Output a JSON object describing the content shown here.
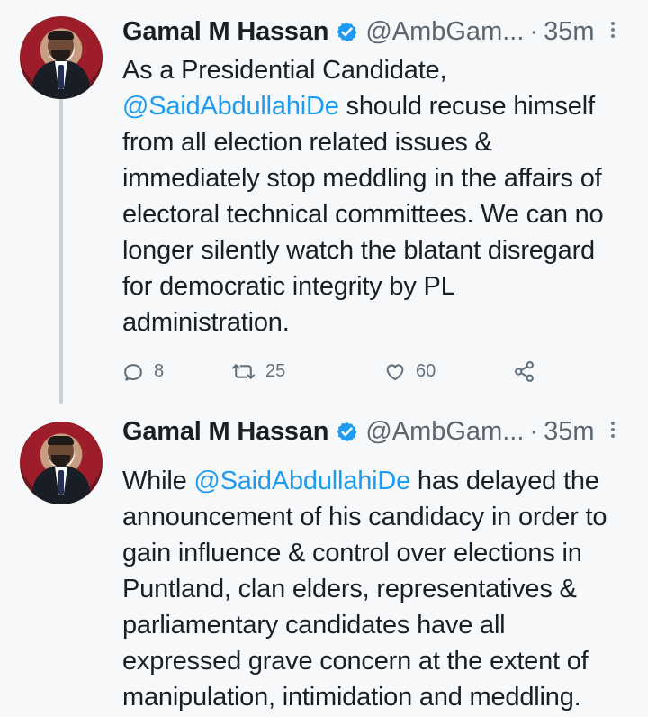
{
  "tweets": [
    {
      "author_name": "Gamal M Hassan",
      "handle": "@AmbGam...",
      "separator": "·",
      "time": "35m",
      "body_parts": [
        {
          "text": "As a Presidential Candidate,\n"
        },
        {
          "text": "@SaidAbdullahiDe",
          "mention": true
        },
        {
          "text": " should recuse himself from all election related issues & immediately stop meddling in the affairs of electoral technical committees. We can no longer silently watch the blatant disregard for democratic integrity by  PL administration."
        }
      ],
      "actions": {
        "replies": "8",
        "retweets": "25",
        "likes": "60"
      }
    },
    {
      "author_name": "Gamal M Hassan",
      "handle": "@AmbGam...",
      "separator": "·",
      "time": "35m",
      "body_parts": [
        {
          "text": "While "
        },
        {
          "text": "@SaidAbdullahiDe",
          "mention": true
        },
        {
          "text": " has delayed the announcement of his candidacy in order to gain influence & control over elections in Puntland, clan elders, representatives & parliamentary candidates have all expressed grave concern at the extent of manipulation, intimidation and meddling."
        }
      ]
    }
  ],
  "icons": {
    "verified": "verified-badge-icon",
    "more": "more-options-icon",
    "reply": "reply-icon",
    "retweet": "retweet-icon",
    "like": "heart-icon",
    "share": "share-icon"
  },
  "colors": {
    "background": "#f7f8fa",
    "text": "#1b1f23",
    "muted": "#5b6670",
    "mention": "#1d9bf0",
    "verified": "#1d9bf0"
  }
}
